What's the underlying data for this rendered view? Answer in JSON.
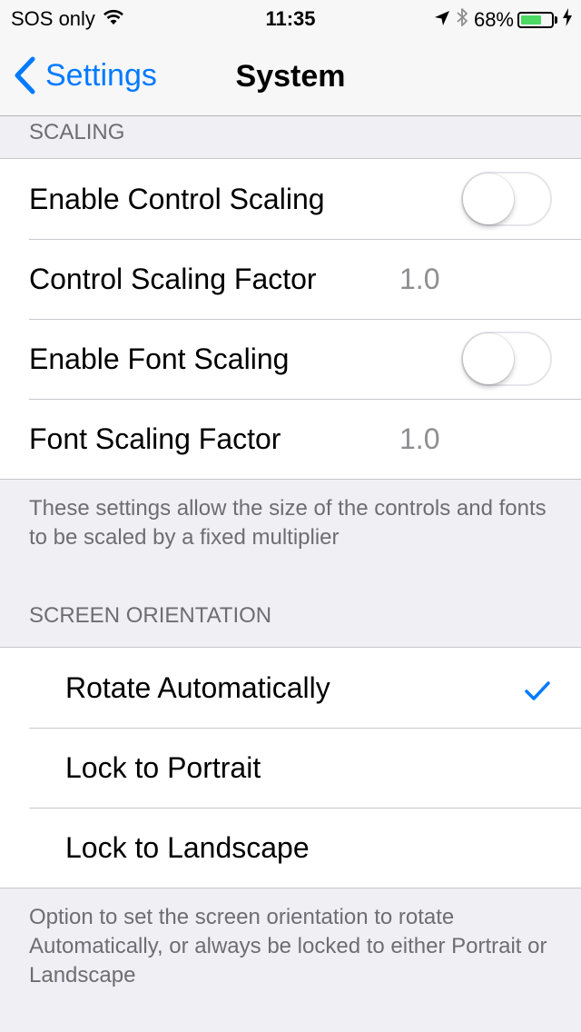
{
  "status_bar": {
    "carrier": "SOS only",
    "time": "11:35",
    "battery_percent": "68%",
    "battery_level": 0.68,
    "icons": [
      "wifi-icon",
      "location-arrow-icon",
      "bluetooth-icon",
      "battery-icon",
      "charging-bolt-icon"
    ]
  },
  "nav": {
    "back_label": "Settings",
    "title": "System"
  },
  "sections": {
    "scaling": {
      "header": "SCALING",
      "rows": [
        {
          "label": "Enable Control Scaling",
          "toggle_on": false
        },
        {
          "label": "Control Scaling Factor",
          "value": "1.0"
        },
        {
          "label": "Enable Font Scaling",
          "toggle_on": false
        },
        {
          "label": "Font Scaling Factor",
          "value": "1.0"
        }
      ],
      "footer": "These settings allow the size of the controls and fonts to be scaled by a fixed multiplier"
    },
    "orientation": {
      "header": "SCREEN ORIENTATION",
      "rows": [
        {
          "label": "Rotate Automatically",
          "selected": true
        },
        {
          "label": "Lock to Portrait",
          "selected": false
        },
        {
          "label": "Lock to Landscape",
          "selected": false
        }
      ],
      "footer": "Option to set the screen orientation to rotate Automatically, or always be locked to either Portrait or Landscape"
    }
  },
  "colors": {
    "accent": "#007aff",
    "toggle_off_border": "#e5e5ea",
    "background": "#efeff4",
    "battery": "#4cd964"
  }
}
